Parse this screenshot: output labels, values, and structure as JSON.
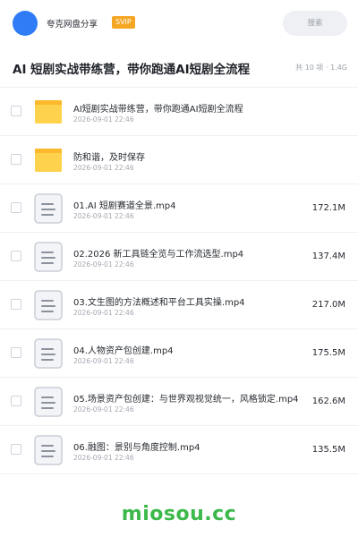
{
  "topbar": {
    "brand_name": "夸克网盘分享",
    "vip_label": "SVIP",
    "search_placeholder": "搜索",
    "avatar_color": "#2f7cf6",
    "vip_color": "#f5a623"
  },
  "header": {
    "title": "AI 短剧实战带练营，带你跑通AI短剧全流程",
    "meta": "共 10 项 · 1.4G"
  },
  "files": [
    {
      "type": "folder",
      "name": "AI短剧实战带练营，带你跑通AI短剧全流程",
      "date": "2026-09-01 22:46",
      "size": ""
    },
    {
      "type": "folder",
      "name": "防和谐，及时保存",
      "date": "2026-09-01 22:46",
      "size": ""
    },
    {
      "type": "video",
      "name": "01.AI 短剧赛道全景.mp4",
      "date": "2026-09-01 22:46",
      "size": "172.1M"
    },
    {
      "type": "video",
      "name": "02.2026 新工具链全览与工作流选型.mp4",
      "date": "2026-09-01 22:46",
      "size": "137.4M"
    },
    {
      "type": "video",
      "name": "03.文生图的方法概述和平台工具实操.mp4",
      "date": "2026-09-01 22:46",
      "size": "217.0M"
    },
    {
      "type": "video",
      "name": "04.人物资产包创建.mp4",
      "date": "2026-09-01 22:46",
      "size": "175.5M"
    },
    {
      "type": "video",
      "name": "05.场景资产包创建：与世界观视觉统一，风格锁定.mp4",
      "date": "2026-09-01 22:46",
      "size": "162.6M"
    },
    {
      "type": "video",
      "name": "06.融图：景别与角度控制.mp4",
      "date": "2026-09-01 22:46",
      "size": "135.5M"
    }
  ],
  "watermark": {
    "text": "miosou.cc",
    "color": "#3cb94a"
  },
  "icons": {
    "folder": "folder-icon",
    "video": "document-icon"
  }
}
